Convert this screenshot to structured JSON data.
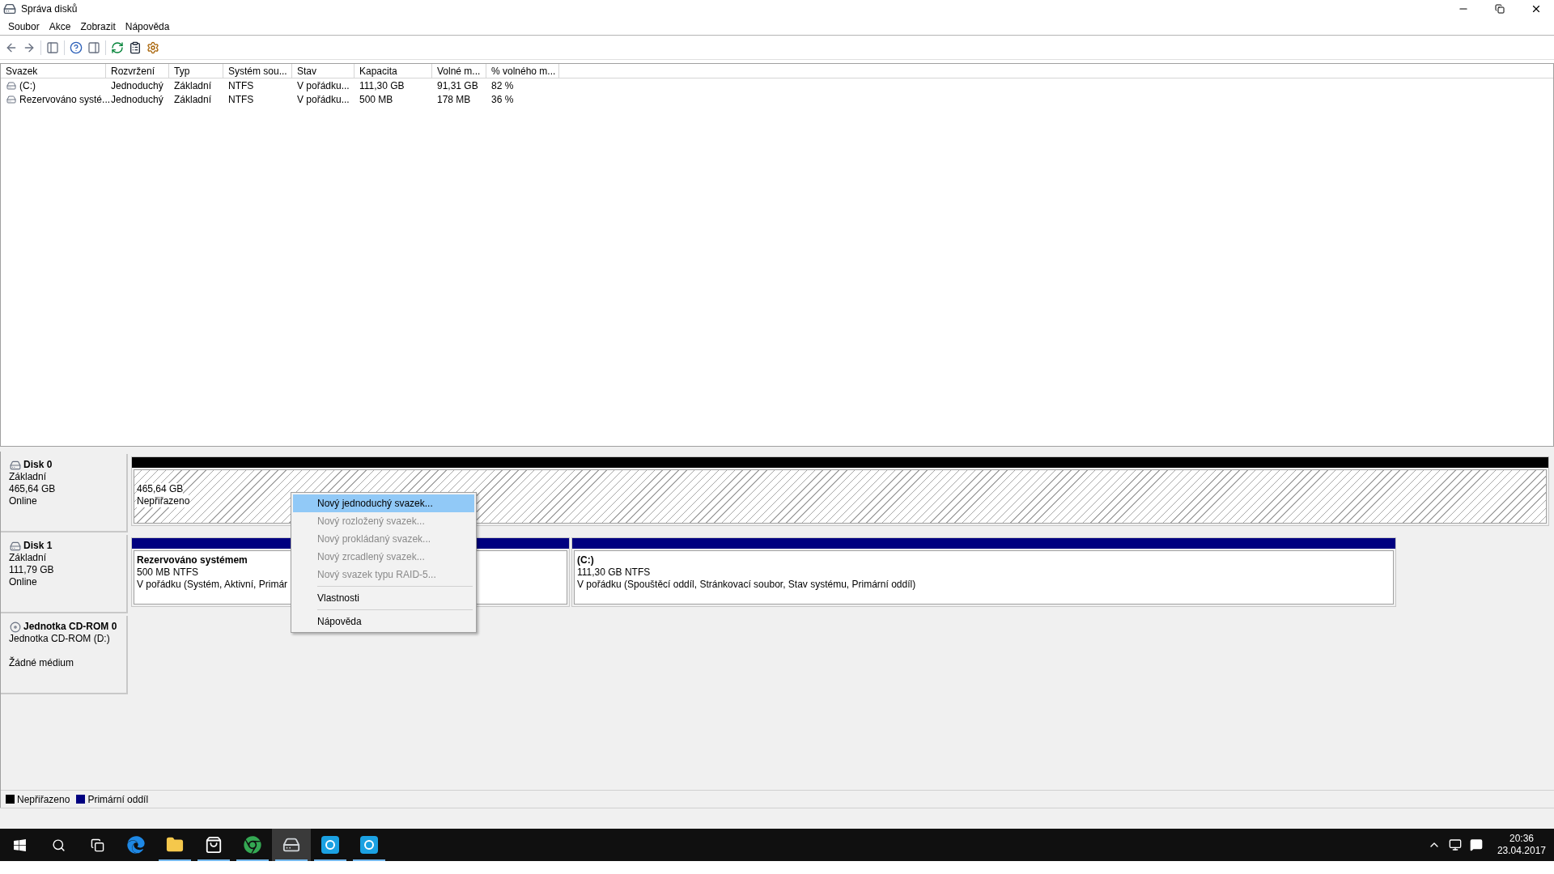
{
  "window": {
    "title": "Správa disků"
  },
  "menu": [
    "Soubor",
    "Akce",
    "Zobrazit",
    "Nápověda"
  ],
  "table": {
    "columns": [
      "Svazek",
      "Rozvržení",
      "Typ",
      "Systém sou...",
      "Stav",
      "Kapacita",
      "Volné m...",
      "% volného m..."
    ],
    "rows": [
      [
        "(C:)",
        "Jednoduchý",
        "Základní",
        "NTFS",
        "V pořádku...",
        "111,30 GB",
        "91,31 GB",
        "82 %"
      ],
      [
        "Rezervováno systé...",
        "Jednoduchý",
        "Základní",
        "NTFS",
        "V pořádku...",
        "500 MB",
        "178 MB",
        "36 %"
      ]
    ]
  },
  "disks": [
    {
      "kind": "disk",
      "name": "Disk 0",
      "type": "Základní",
      "size": "465,64 GB",
      "status": "Online",
      "partitions": [
        {
          "kind": "unallocated",
          "info": "465,64 GB",
          "status": "Nepřiřazeno"
        }
      ]
    },
    {
      "kind": "disk",
      "name": "Disk 1",
      "type": "Základní",
      "size": "111,79 GB",
      "status": "Online",
      "partitions": [
        {
          "kind": "primary",
          "name": "Rezervováno systémem",
          "info": "500 MB NTFS",
          "status": "V pořádku (Systém, Aktivní, Primár"
        },
        {
          "kind": "primary",
          "name": "(C:)",
          "info": "111,30 GB NTFS",
          "status": "V pořádku (Spouštěcí oddíl, Stránkovací soubor, Stav systému, Primární oddíl)"
        }
      ]
    },
    {
      "kind": "cdrom",
      "name": "Jednotka CD-ROM 0",
      "type": "Jednotka CD-ROM (D:)",
      "status": "Žádné médium"
    }
  ],
  "context_menu": [
    {
      "label": "Nový jednoduchý svazek...",
      "disabled": false,
      "selected": true
    },
    {
      "label": "Nový rozložený svazek...",
      "disabled": true,
      "selected": false
    },
    {
      "label": "Nový prokládaný svazek...",
      "disabled": true,
      "selected": false
    },
    {
      "label": "Nový zrcadlený svazek...",
      "disabled": true,
      "selected": false
    },
    {
      "label": "Nový svazek typu RAID-5...",
      "disabled": true,
      "selected": false,
      "separator_after": true
    },
    {
      "label": "Vlastnosti",
      "disabled": false,
      "selected": false,
      "separator_after": true
    },
    {
      "label": "Nápověda",
      "disabled": false,
      "selected": false
    }
  ],
  "legend": [
    {
      "label": "Nepřiřazeno",
      "color": "#000000"
    },
    {
      "label": "Primární oddíl",
      "color": "#000080"
    }
  ],
  "taskbar": {
    "apps": [
      {
        "kind": "edge",
        "running": false,
        "selected": false
      },
      {
        "kind": "folder",
        "running": true,
        "selected": false
      },
      {
        "kind": "store",
        "running": true,
        "selected": false
      },
      {
        "kind": "chrome",
        "running": true,
        "selected": false
      },
      {
        "kind": "diskmgmt",
        "running": true,
        "selected": true
      },
      {
        "kind": "app",
        "running": true,
        "selected": false
      },
      {
        "kind": "app",
        "running": true,
        "selected": false
      }
    ],
    "time": "20:36",
    "date": "23.04.2017"
  }
}
